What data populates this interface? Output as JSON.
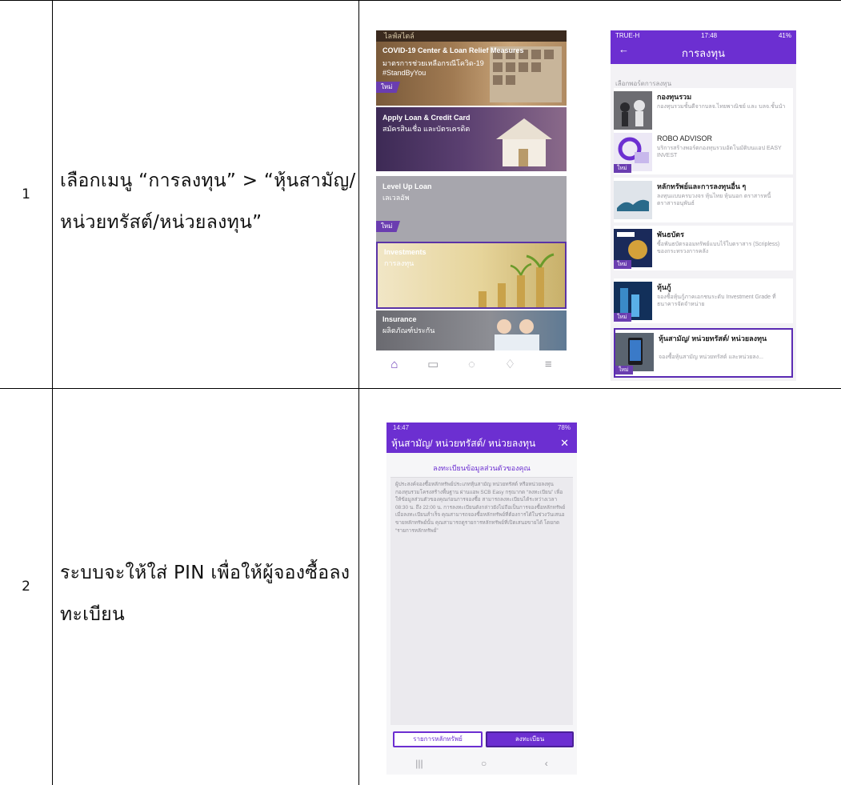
{
  "rows": [
    {
      "num": "1",
      "desc": "เลือกเมนู “การลงทุน” > “หุ้นสามัญ/หน่วยทรัสต์/หน่วยลงทุน”"
    },
    {
      "num": "2",
      "desc": "ระบบจะให้ใส่ PIN เพื่อให้ผู้จองซื้อลงทะเบียน"
    }
  ],
  "home": {
    "status": "ไลฟ์สไตล์",
    "banners": [
      {
        "t1": "COVID-19 Center & Loan Relief Measures",
        "t2": "มาตรการช่วยเหลือกรณีโควิด-19",
        "t3": "#StandByYou",
        "tag": "ใหม่"
      },
      {
        "t1": "Apply Loan & Credit Card",
        "t2": "สมัครสินเชื่อ และบัตรเครดิต"
      },
      {
        "t1": "Level Up Loan",
        "t2": "เลเวลอัพ",
        "tag": "ใหม่"
      },
      {
        "t1": "Investments",
        "t2": "การลงทุน"
      },
      {
        "t1": "Insurance",
        "t2": "ผลิตภัณฑ์ประกัน"
      }
    ],
    "nav_icons": [
      "home-icon",
      "wallet-icon",
      "scan-icon",
      "bell-icon",
      "menu-icon"
    ]
  },
  "invest": {
    "carrier": "TRUE-H",
    "time": "17:48",
    "battery": "41%",
    "title": "การลงทุน",
    "section": "เลือกพอร์ตการลงทุน",
    "tag": "ใหม่",
    "items": [
      {
        "name": "กองทุนรวม",
        "sub": "กองทุนรวมชั้นดีจากบลจ.ไทยพาณิชย์ และ บลจ.ชั้นนำ"
      },
      {
        "name": "ROBO ADVISOR",
        "sub": "บริการสร้างพอร์ตกองทุนรวมอัตโนมัติบนแอป EASY INVEST"
      },
      {
        "name": "หลักทรัพย์และการลงทุนอื่น ๆ",
        "sub": "ลงทุนแบบครบวงจร หุ้นไทย หุ้นนอก ตราสารหนี้ ตราสารอนุพันธ์"
      },
      {
        "name": "พันธบัตร",
        "sub": "ซื้อพันธบัตรออมทรัพย์แบบไร้ใบตราสาร (Scripless) ของกระทรวงการคลัง"
      },
      {
        "name": "หุ้นกู้",
        "sub": "จองซื้อหุ้นกู้ภาคเอกชนระดับ Investment Grade ที่ธนาคารจัดจำหน่าย"
      },
      {
        "name": "หุ้นสามัญ/ หน่วยทรัสต์/ หน่วยลงทุน",
        "sub": "จองซื้อหุ้นสามัญ หน่วยทรัสต์ และหน่วยลง..."
      }
    ]
  },
  "register": {
    "time": "14:47",
    "battery": "78%",
    "title": "หุ้นสามัญ/ หน่วยทรัสต์/ หน่วยลงทุน",
    "subtitle": "ลงทะเบียนข้อมูลส่วนตัวของคุณ",
    "body": "ผู้ประสงค์จองซื้อหลักทรัพย์ประเภทหุ้นสามัญ หน่วยทรัสต์ หรือหน่วยลงทุน กองทุนรวมโครงสร้างพื้นฐาน ผ่านแอพ SCB Easy กรุณากด “ลงทะเบียน” เพื่อให้ข้อมูลส่วนตัวของคุณก่อนการจองซื้อ สามารถลงทะเบียนได้ระหว่างเวลา 08:30 น. ถึง 22:00 น. การลงทะเบียนดังกล่าวยังไม่ถือเป็นการจองซื้อหลักทรัพย์ เมื่อลงทะเบียนสำเร็จ คุณสามารถจองซื้อหลักทรัพย์ที่ต้องการได้ในช่วงวันเสนอขายหลักทรัพย์นั้น คุณสามารถดูรายการหลักทรัพย์ที่เปิดเสนอขายได้ โดยกด “รายการหลักทรัพย์”",
    "btn_list": "รายการหลักทรัพย์",
    "btn_register": "ลงทะเบียน"
  }
}
